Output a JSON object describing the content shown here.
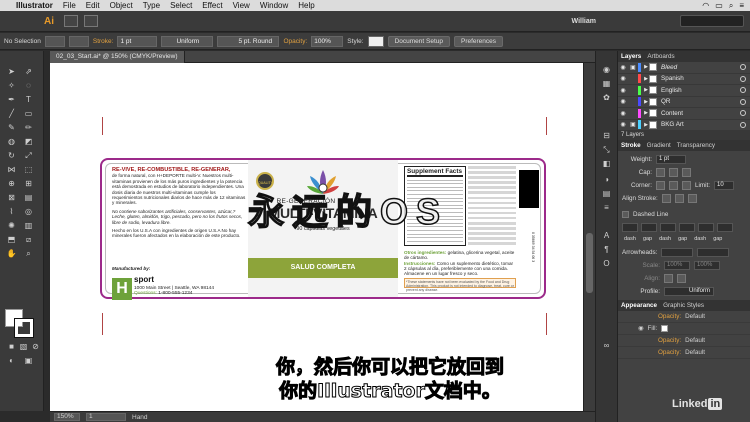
{
  "menubar": {
    "app_name": "Illustrator",
    "menus": [
      "File",
      "Edit",
      "Object",
      "Type",
      "Select",
      "Effect",
      "View",
      "Window",
      "Help"
    ]
  },
  "appbar": {
    "logo": "Ai",
    "user": "William"
  },
  "control": {
    "selection": "No Selection",
    "stroke_label": "Stroke:",
    "stroke_weight": "1 pt",
    "profile": "Uniform",
    "brush": "5 pt. Round",
    "opacity_label": "Opacity:",
    "opacity_value": "100%",
    "style_label": "Style:",
    "doc_setup": "Document Setup",
    "preferences": "Preferences"
  },
  "document": {
    "tab": "02_03_Start.ai* @ 150% (CMYK/Preview)"
  },
  "label": {
    "headline": "RE-VIVE, RE-COMBUSTIBLE, RE-GENERAR,",
    "intro": "de forma natural, con H+DEPORTE multi-V. Nuestros multi-vitaminas provienen de los más puros ingredientes y la potencia está demostrada en estudios de laboratorio independientes. Una dosis diaria de nuestros multi-vitaminas cumple los requerimientos nutricionales diarios de hace más de 12 vitaminas y minerales.",
    "no_contain": "No contiene saborizantes artificiales, conservantes, azúcar,? Leche, gluten, almidón, trigo, pescado, pero no los frutos secos, libre de sodio, levadura libre.",
    "made_in": "Hecho en los U.S.A con ingredientes de origen U.S.A No hay minerales fueron afectados en la elaboración de este producto.",
    "manufactured_by": "Manufactured by:",
    "brand_logo": "H",
    "brand_name": "sport",
    "address": "1000 Main Street  |  Seattle, WA 98144",
    "questions_label": "Questions:",
    "phone": "1-800-555-1234",
    "quality_badge": "QUALITY",
    "subtitle": "RE-GENERACIÓN NATURAL",
    "product_name": "MULTI-VITAMINA",
    "capsules": "90 cápsulas vegetales",
    "band": "SALUD COMPLETA",
    "facts_title": "Supplement Facts",
    "other_label": "Otros ingredientes:",
    "other_text": "gelatina, glicerina vegetal, aceite de cártamo.",
    "usage_label": "Instrucciones:",
    "usage_text": "Como un suplemento dietético, tomar 2 cápsulas al día, preferiblemente con una comida. Almacene en un lugar fresco y seco.",
    "fda": "*These statements have not been evaluated by the Food and Drug Administration. This product is not intended to diagnose, treat, cure or prevent any disease.",
    "barcode_number": "0 35669 34 54 06 3"
  },
  "overlay": {
    "watermark": "永 远 的 O S",
    "subtitle_line1": "你，然后你可以把它放回到",
    "subtitle_line2": "你的Illustrator文档中。",
    "brand": "Linked",
    "brand_in": "in"
  },
  "status": {
    "zoom": "150%",
    "page": "1",
    "tool": "Hand"
  },
  "layers_panel": {
    "tabs": [
      "Layers",
      "Artboards"
    ],
    "layers": [
      {
        "name": "Bleed",
        "color": "#4a8cff",
        "italic": true
      },
      {
        "name": "Spanish",
        "color": "#ff4a4a",
        "italic": false
      },
      {
        "name": "English",
        "color": "#4aff4a",
        "italic": false
      },
      {
        "name": "QR",
        "color": "#4a4aff",
        "italic": false
      },
      {
        "name": "Content",
        "color": "#ff4aff",
        "italic": false
      },
      {
        "name": "BKG Art",
        "color": "#4ad0ff",
        "italic": false
      }
    ],
    "count": "7 Layers"
  },
  "stroke_panel": {
    "tabs": [
      "Stroke",
      "Gradient",
      "Transparency"
    ],
    "weight_label": "Weight:",
    "weight_value": "1 pt",
    "cap_label": "Cap:",
    "corner_label": "Corner:",
    "limit_label": "Limit:",
    "limit_value": "10",
    "align_label": "Align Stroke:",
    "dashed_label": "Dashed Line",
    "dash_labels": [
      "dash",
      "gap",
      "dash",
      "gap",
      "dash",
      "gap"
    ],
    "arrowheads_label": "Arrowheads:",
    "scale_label": "Scale:",
    "scale_values": [
      "100%",
      "100%"
    ],
    "align_arrow_label": "Align:",
    "profile_label": "Profile:",
    "profile_value": "Uniform"
  },
  "appearance_panel": {
    "tabs": [
      "Appearance",
      "Graphic Styles"
    ],
    "rows": [
      {
        "label": "Opacity:",
        "value": "Default"
      },
      {
        "label": "Fill:",
        "value": ""
      },
      {
        "label": "Opacity:",
        "value": "Default"
      },
      {
        "label": "Opacity:",
        "value": "Default"
      }
    ]
  }
}
